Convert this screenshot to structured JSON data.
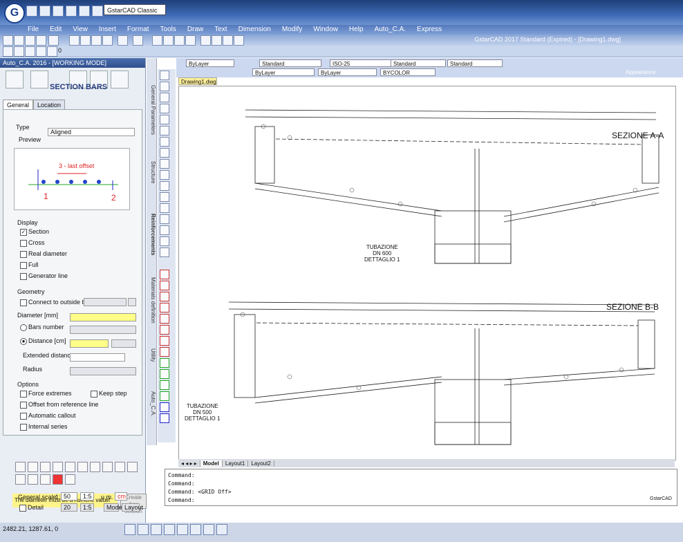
{
  "titlebar": {
    "logo": "G",
    "profile": "GstarCAD Classic",
    "app_title": "GstarCAD 2017 Standard (Expired) - [Drawing1.dwg]"
  },
  "menu": [
    "File",
    "Edit",
    "View",
    "Insert",
    "Format",
    "Tools",
    "Draw",
    "Text",
    "Dimension",
    "Modify",
    "Window",
    "Help",
    "Auto_C.A.",
    "Express"
  ],
  "toolbar": {
    "layer": "ByLayer",
    "textstyle": "Standard",
    "dimstyle": "ISO-25",
    "tablestyle": "Standard",
    "mlstyle": "Standard",
    "linetype": "ByLayer",
    "lineweight": "ByLayer",
    "color": "BYCOLOR",
    "plot": "0"
  },
  "panel": {
    "title": "Auto_C.A. 2016 - [WORKING MODE]",
    "close_icon": "close-icon",
    "section_label": "SECTION BARS",
    "tabs": [
      "General",
      "Location"
    ],
    "type_label": "Type",
    "type_value": "Aligned",
    "preview_label": "Preview",
    "preview": {
      "offset_text": "3 - last offset",
      "p1": "1",
      "p2": "2"
    },
    "display_label": "Display",
    "display_items": [
      {
        "label": "Section",
        "checked": true
      },
      {
        "label": "Cross",
        "checked": false
      },
      {
        "label": "Real diameter",
        "checked": false
      },
      {
        "label": "Full",
        "checked": false
      },
      {
        "label": "Generator line",
        "checked": false
      }
    ],
    "geometry_label": "Geometry",
    "connect_label": "Connect to outside bar",
    "diameter_label": "Diameter [mm]",
    "bars_number_label": "Bars number",
    "distance_label": "Distance [cm]",
    "extended_label": "Extended distance",
    "radius_label": "Radius",
    "options_label": "Options",
    "option_items": [
      "Force extremes",
      "Offset from reference line",
      "Automatic callout",
      "Internal series"
    ],
    "keep_step": "Keep step",
    "status_message": "The diameter must be a numeric value!",
    "create_button": "Create\nbar section",
    "general_scale_label": "General scale",
    "scale_sep": "1:",
    "scale_value": "50",
    "scale_ratio": "1:5",
    "um_label": "u.m.",
    "um_value": "cm",
    "detail_label": "Detail",
    "detail_value": "20",
    "detail_ratio": "1:5",
    "model_btn": "Model",
    "layout_btn": "Layout"
  },
  "vtabs": [
    "General Parameters",
    "Structure",
    "Reinforcements",
    "Materials definition",
    "Utility",
    "Auto_C.A."
  ],
  "document": {
    "tab": "Drawing1.dwg"
  },
  "drawing": {
    "section_a": "SEZIONE A-A",
    "section_b": "SEZIONE B-B",
    "pipe_a": [
      "TUBAZIONE",
      "DN 600",
      "DETTAGLIO 1"
    ],
    "pipe_b": [
      "TUBAZIONE",
      "DN 500",
      "DETTAGLIO 1"
    ]
  },
  "layout_tabs": [
    "Model",
    "Layout1",
    "Layout2"
  ],
  "commands": [
    "Command:",
    "Command:",
    "Command: <GRID Off>",
    "Command:"
  ],
  "status": {
    "coords": "2482.21, 1287.61, 0",
    "brand": "GstarCAD",
    "appearance": "Appearance"
  }
}
